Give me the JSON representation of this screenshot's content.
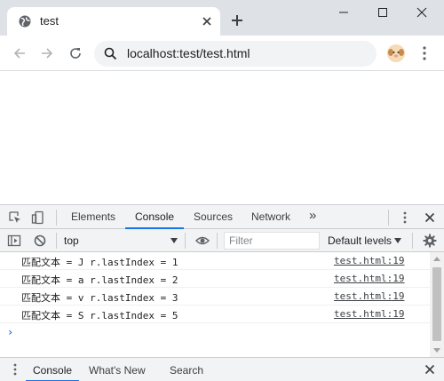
{
  "browser": {
    "tab": {
      "title": "test",
      "favicon": "globe-icon"
    },
    "address_bar": {
      "url": "localhost:test/test.html"
    }
  },
  "devtools": {
    "tabs": [
      {
        "label": "Elements",
        "active": false
      },
      {
        "label": "Console",
        "active": true
      },
      {
        "label": "Sources",
        "active": false
      },
      {
        "label": "Network",
        "active": false
      }
    ],
    "more_tabs_label": "»",
    "context": "top",
    "filter_placeholder": "Filter",
    "levels_label": "Default levels",
    "messages": [
      {
        "text": "匹配文本 = J r.lastIndex = 1",
        "source": "test.html:19"
      },
      {
        "text": "匹配文本 = a r.lastIndex = 2",
        "source": "test.html:19"
      },
      {
        "text": "匹配文本 = v r.lastIndex = 3",
        "source": "test.html:19"
      },
      {
        "text": "匹配文本 = S r.lastIndex = 5",
        "source": "test.html:19"
      }
    ],
    "prompt_symbol": "›",
    "drawer_tabs": [
      {
        "label": "Console",
        "active": true
      },
      {
        "label": "What's New",
        "active": false
      },
      {
        "label": "Search",
        "active": false
      }
    ]
  },
  "colors": {
    "accent": "#1a73e8",
    "chrome_bg": "#dee1e6",
    "devtools_bg": "#f1f3f4"
  }
}
